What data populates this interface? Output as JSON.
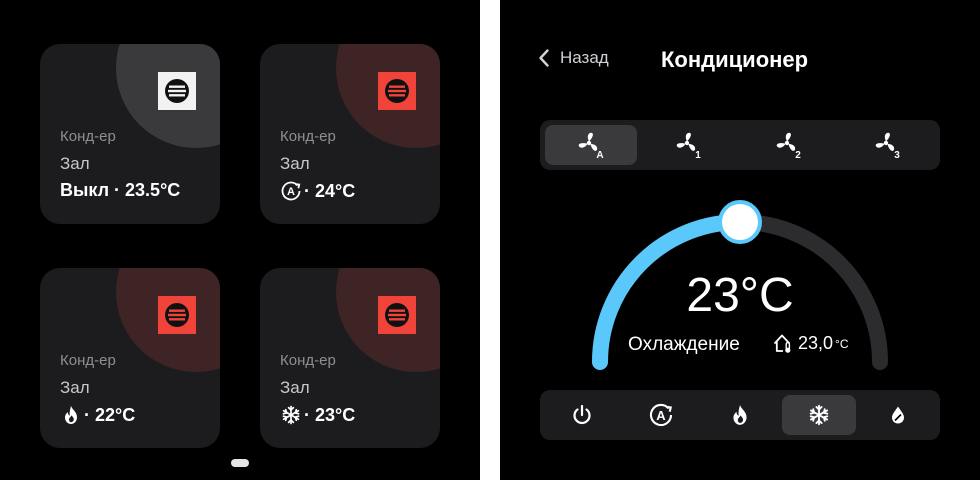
{
  "cards": [
    {
      "type": "Конд-ер",
      "room": "Зал",
      "mode": "off",
      "status": "Выкл · 23.5°C"
    },
    {
      "type": "Конд-ер",
      "room": "Зал",
      "mode": "auto",
      "status": "· 24°C"
    },
    {
      "type": "Конд-ер",
      "room": "Зал",
      "mode": "heat",
      "status": "· 22°C"
    },
    {
      "type": "Конд-ер",
      "room": "Зал",
      "mode": "cool",
      "status": "· 23°C"
    }
  ],
  "ac": {
    "back_label": "Назад",
    "title": "Кондиционер",
    "fan_modes": [
      {
        "icon": "fan-auto-icon",
        "sub": "A",
        "selected": true
      },
      {
        "icon": "fan-speed-1-icon",
        "sub": "1",
        "selected": false
      },
      {
        "icon": "fan-speed-2-icon",
        "sub": "2",
        "selected": false
      },
      {
        "icon": "fan-speed-3-icon",
        "sub": "3",
        "selected": false
      }
    ],
    "target_temp": "23°C",
    "target_fraction": 0.5,
    "mode_label": "Охлаждение",
    "indoor_temp": "23,0",
    "indoor_unit": "°C",
    "modes": [
      {
        "icon": "power-icon",
        "selected": false
      },
      {
        "icon": "auto-mode-icon",
        "selected": false
      },
      {
        "icon": "flame-icon",
        "selected": false
      },
      {
        "icon": "snowflake-icon",
        "selected": true
      },
      {
        "icon": "dry-mode-icon",
        "selected": false
      }
    ]
  },
  "colors": {
    "accent": "#5ac8fa",
    "badge_on": "#f0433a",
    "badge_off": "#f2f2f2",
    "card_bg": "#1c1c1e"
  }
}
